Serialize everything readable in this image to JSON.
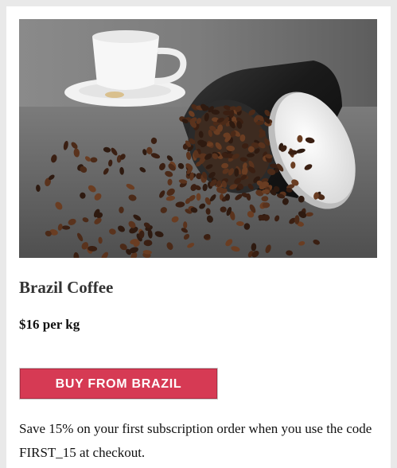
{
  "product": {
    "name": "Brazil Coffee",
    "price": "$16 per kg",
    "buy_label": "BUY FROM BRAZIL",
    "promo_text": "Save 15% on your first subscription order when you use the code FIRST_15 at checkout."
  },
  "image": {
    "subject": "spilled-coffee-beans-canister-and-cup-photo"
  },
  "colors": {
    "button": "#d63a54",
    "page_background": "#e9e9e9",
    "card_background": "#ffffff"
  }
}
